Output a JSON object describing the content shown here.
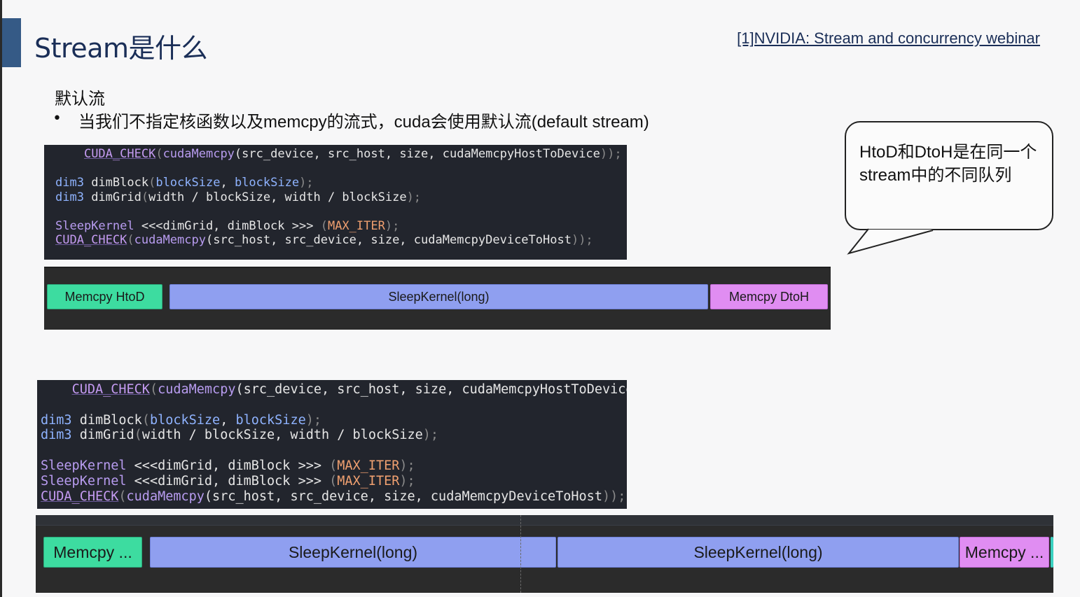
{
  "slide": {
    "title": "Stream是什么",
    "reference_link": "[1]NVIDIA: Stream and concurrency webinar",
    "section_heading": "默认流",
    "bullet_symbol": "•",
    "bullet_text": "当我们不指定核函数以及memcpy的流式，cuda会使用默认流(default stream)"
  },
  "code_block_1": {
    "lines": [
      [
        [
          "    ",
          "pl"
        ],
        [
          "CUDA_CHECK",
          "mac"
        ],
        [
          "(",
          "dim"
        ],
        [
          "cudaMemcpy",
          "fn"
        ],
        [
          "(src_device, src_host, size, cudaMemcpyHostToDevice",
          "pl"
        ],
        [
          "));",
          "dim"
        ]
      ],
      [
        [
          "",
          ""
        ]
      ],
      [
        [
          "dim3",
          "kw"
        ],
        [
          " dimBlock",
          "pl"
        ],
        [
          "(",
          "dim"
        ],
        [
          "blockSize",
          "kw"
        ],
        [
          ", ",
          "pl"
        ],
        [
          "blockSize",
          "kw"
        ],
        [
          ");",
          "dim"
        ]
      ],
      [
        [
          "dim3",
          "kw"
        ],
        [
          " dimGrid",
          "pl"
        ],
        [
          "(",
          "dim"
        ],
        [
          "width / blockSize, width / blockSize",
          "pl"
        ],
        [
          ");",
          "dim"
        ]
      ],
      [
        [
          "",
          ""
        ]
      ],
      [
        [
          "SleepKernel",
          "fn"
        ],
        [
          " <<<dimGrid, dimBlock >>> ",
          "pl"
        ],
        [
          "(",
          "dim"
        ],
        [
          "MAX_ITER",
          "num"
        ],
        [
          ");",
          "dim"
        ]
      ],
      [
        [
          "CUDA_CHECK",
          "mac"
        ],
        [
          "(",
          "dim"
        ],
        [
          "cudaMemcpy",
          "fn"
        ],
        [
          "(src_host, src_device, size, cudaMemcpyDeviceToHost",
          "pl"
        ],
        [
          "));",
          "dim"
        ]
      ]
    ]
  },
  "timeline_1": {
    "segments": [
      {
        "label": "Memcpy HtoD",
        "color": "green"
      },
      {
        "label": "SleepKernel(long)",
        "color": "blue"
      },
      {
        "label": "Memcpy DtoH",
        "color": "pink"
      }
    ]
  },
  "callout": {
    "text": "HtoD和DtoH是在同一个stream中的不同队列"
  },
  "code_block_2": {
    "lines": [
      [
        [
          "    ",
          "pl"
        ],
        [
          "CUDA_CHECK",
          "mac"
        ],
        [
          "(",
          "dim"
        ],
        [
          "cudaMemcpy",
          "fn"
        ],
        [
          "(src_device, src_host, size, cudaMemcpyHostToDevice",
          "pl"
        ],
        [
          "));",
          "dim"
        ]
      ],
      [
        [
          "",
          ""
        ]
      ],
      [
        [
          "dim3",
          "kw"
        ],
        [
          " dimBlock",
          "pl"
        ],
        [
          "(",
          "dim"
        ],
        [
          "blockSize",
          "kw"
        ],
        [
          ", ",
          "pl"
        ],
        [
          "blockSize",
          "kw"
        ],
        [
          ");",
          "dim"
        ]
      ],
      [
        [
          "dim3",
          "kw"
        ],
        [
          " dimGrid",
          "pl"
        ],
        [
          "(",
          "dim"
        ],
        [
          "width / blockSize, width / blockSize",
          "pl"
        ],
        [
          ");",
          "dim"
        ]
      ],
      [
        [
          "",
          ""
        ]
      ],
      [
        [
          "SleepKernel",
          "fn"
        ],
        [
          " <<<dimGrid, dimBlock >>> ",
          "pl"
        ],
        [
          "(",
          "dim"
        ],
        [
          "MAX_ITER",
          "num"
        ],
        [
          ");",
          "dim"
        ]
      ],
      [
        [
          "SleepKernel",
          "fn"
        ],
        [
          " <<<dimGrid, dimBlock >>> ",
          "pl"
        ],
        [
          "(",
          "dim"
        ],
        [
          "MAX_ITER",
          "num"
        ],
        [
          ");",
          "dim"
        ]
      ],
      [
        [
          "CUDA_CHECK",
          "mac"
        ],
        [
          "(",
          "dim"
        ],
        [
          "cudaMemcpy",
          "fn"
        ],
        [
          "(src_host, src_device, size, cudaMemcpyDeviceToHost",
          "pl"
        ],
        [
          "));",
          "dim"
        ]
      ]
    ]
  },
  "timeline_2": {
    "segments": [
      {
        "label": "Memcpy ...",
        "color": "green"
      },
      {
        "label": "SleepKernel(long)",
        "color": "blue"
      },
      {
        "label": "SleepKernel(long)",
        "color": "blue"
      },
      {
        "label": "Memcpy ...",
        "color": "pink"
      }
    ]
  }
}
